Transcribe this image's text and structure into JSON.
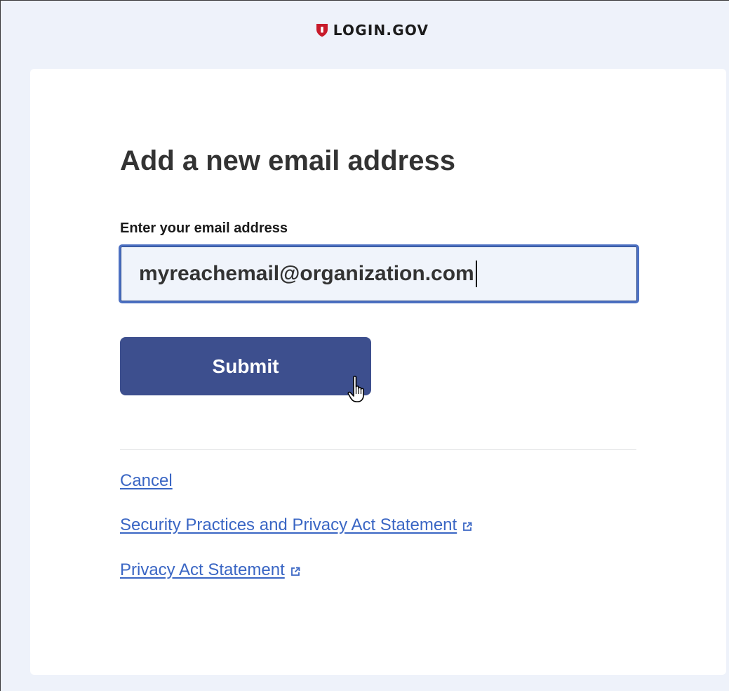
{
  "header": {
    "logo_text": "LOGIN.GOV",
    "logo_icon": "shield-icon",
    "brand_color": "#c81b2b"
  },
  "main": {
    "title": "Add a new email address",
    "email_label": "Enter your email address",
    "email_value": "myreachemail@organization.com",
    "submit_label": "Submit"
  },
  "links": {
    "cancel": "Cancel",
    "security": "Security Practices and Privacy Act Statement",
    "privacy": "Privacy Act Statement",
    "external_icon": "external-link-icon"
  },
  "colors": {
    "page_bg": "#eef2fa",
    "button_bg": "#3d4f8e",
    "link": "#3a66c4",
    "input_border": "#4c70c2"
  }
}
